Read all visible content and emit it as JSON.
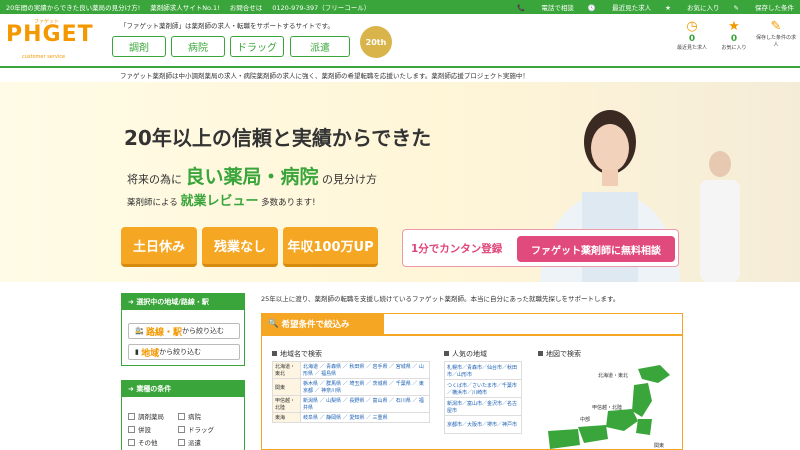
{
  "topbar": {
    "message": "20年間の実績からできた良い薬局の見分け方!",
    "site_label": "薬剤師求人サイトNo.1!",
    "inquiry_label": "お問合せは",
    "phone": "0120-979-397（フリーコール）",
    "links": [
      "電話で相談",
      "最近見た求人",
      "お気に入り",
      "保存した条件"
    ]
  },
  "header": {
    "logo": "PHGET",
    "logo_ruby": "ファゲット",
    "logo_sub": "customer service",
    "tagline": "「ファゲット薬剤師」は薬剤師の求人・転職をサポートするサイトです。",
    "nav": [
      "調剤",
      "病院",
      "ドラッグ",
      "派遣"
    ],
    "anniversary_badge": "20th",
    "counters": [
      {
        "icon": "clock-icon",
        "value": "0",
        "label": "最近見た求人"
      },
      {
        "icon": "star-icon",
        "value": "0",
        "label": "お気に入り"
      },
      {
        "icon": "edit-icon",
        "value": "",
        "label": "保存した条件の求人"
      }
    ]
  },
  "description": "ファゲット薬剤師は中小調剤薬局の求人・病院薬剤師の求人に強く、薬剤師の希望転職を応援いたします。薬剤師応援プロジェクト実施中！",
  "hero": {
    "headline": "20年以上の信頼と実績からできた",
    "line2_prefix": "将来の為に",
    "line2_emphasis": "良い薬局・病院",
    "line2_suffix": "の見分け方",
    "line3_prefix": "薬剤師による",
    "line3_emphasis": "就業レビュー",
    "line3_suffix": "多数あります!",
    "features": [
      "土日休み",
      "残業なし",
      "年収100万UP"
    ],
    "cta_text": "1分でカンタン登録",
    "cta_button": "ファゲット薬剤師に無料相談"
  },
  "sidebar": {
    "area_title": "選択中の地域/路線・駅",
    "route_button_emph": "路線・駅",
    "route_button_rest": "から絞り込む",
    "area_button_emph": "地域",
    "area_button_rest": "から絞り込む",
    "industry_title": "業種の条件",
    "industries": [
      "調剤薬局",
      "病院",
      "併設",
      "ドラッグ",
      "その他",
      "派遣"
    ]
  },
  "main": {
    "intro": "25年以上に渡り、薬剤師の転職を支援し続けているファゲット薬剤師。本当に自分にあった就職先探しをサポートします。",
    "search_title": "希望条件で絞込み",
    "region_title": "地域名で検索",
    "popular_title": "人気の地域",
    "map_title": "地図で検索",
    "regions": [
      {
        "region": "北海道・東北",
        "prefs": "北海道 ／ 青森県 ／ 秋田県 ／ 岩手県 ／ 宮城県 ／ 山形県 ／ 福島県"
      },
      {
        "region": "関東",
        "prefs": "栃木県 ／ 群馬県 ／ 埼玉県 ／ 茨城県 ／ 千葉県 ／ 東京都 ／ 神奈川県"
      },
      {
        "region": "甲信越・北陸",
        "prefs": "新潟県 ／ 山梨県 ／ 長野県 ／ 富山県 ／ 石川県 ／ 福井県"
      },
      {
        "region": "東海",
        "prefs": "岐阜県 ／ 静岡県 ／ 愛知県 ／ 三重県"
      }
    ],
    "popular": [
      "札幌市／青森市／仙台市／秋田市／山形市",
      "つくば市／さいたま市／千葉市／横浜市／川崎市",
      "新潟市／富山市／金沢市／名古屋市",
      "京都市／大阪市／堺市／神戸市"
    ],
    "map_labels": [
      "北海道・東北",
      "甲信越・北陸",
      "中部",
      "関東"
    ]
  }
}
